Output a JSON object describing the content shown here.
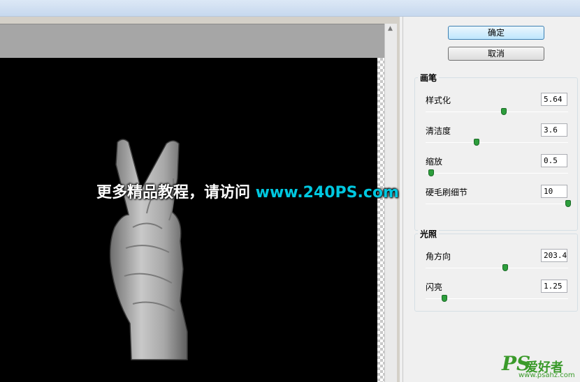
{
  "buttons": {
    "ok_label": "确定",
    "cancel_label": "取消"
  },
  "brush": {
    "title": "画笔",
    "stylization": {
      "label": "样式化",
      "value": "5.64",
      "level": 0.55
    },
    "cleanliness": {
      "label": "清洁度",
      "value": "3.6",
      "level": 0.36
    },
    "scale": {
      "label": "缩放",
      "value": "0.5",
      "level": 0.04
    },
    "bristle_detail": {
      "label": "硬毛刷细节",
      "value": "10",
      "level": 1.0
    }
  },
  "lighting": {
    "title": "光照",
    "angle": {
      "label": "角方向",
      "value": "203.4",
      "level": 0.56
    },
    "shine": {
      "label": "闪亮",
      "value": "1.25",
      "level": 0.13
    }
  },
  "watermark": {
    "text": "更多精品教程，请访问 ",
    "url": "www.240PS.com"
  },
  "logo": {
    "mark": "PS",
    "name": "爱好者",
    "url": "www.psahz.com"
  },
  "colors": {
    "accent": "#2d9e3c",
    "watermark_url": "#00c8e0"
  }
}
